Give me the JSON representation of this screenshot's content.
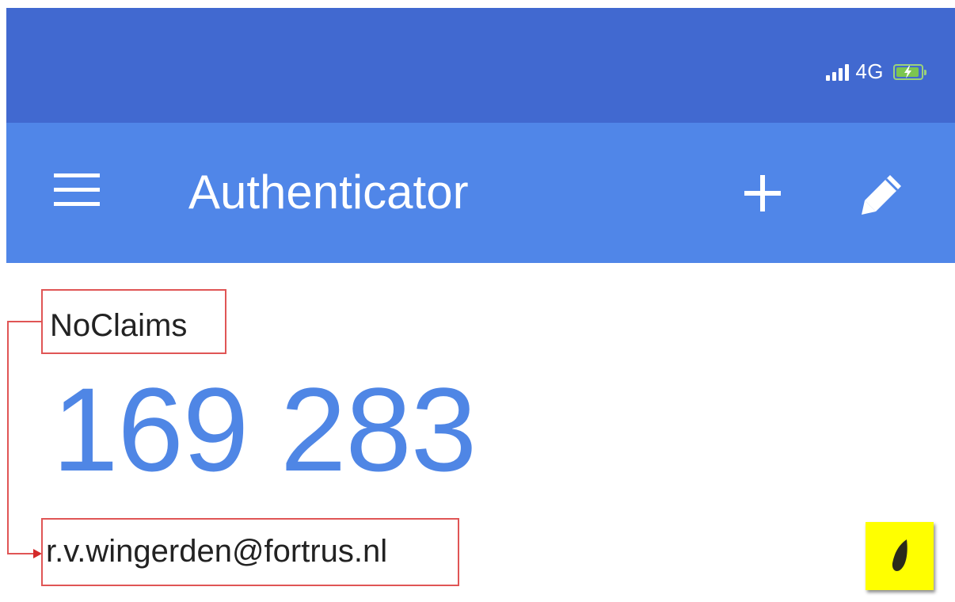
{
  "status_bar": {
    "network": "4G",
    "icons": [
      "signal-icon",
      "battery-charging-icon"
    ],
    "battery_color": "#7cc550"
  },
  "app_bar": {
    "title": "Authenticator",
    "icons": [
      "menu-icon",
      "plus-icon",
      "pencil-icon"
    ],
    "color": "#5086e8"
  },
  "account": {
    "issuer": "NoClaims",
    "code": "169 283",
    "email": "r.v.wingerden@fortrus.nl",
    "code_color": "#4f86e5",
    "timer_icon": "countdown-timer-icon",
    "timer_background": "#ffff00"
  },
  "annotations": {
    "highlight_color": "#e05555",
    "connector_icon": "arrow-icon"
  }
}
